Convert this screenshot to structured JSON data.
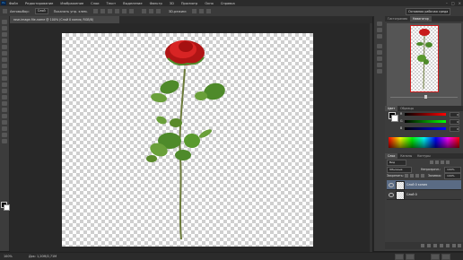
{
  "menu": {
    "app_icon": "Ps",
    "items": [
      "Файл",
      "Редактирование",
      "Изображение",
      "Слои",
      "Текст",
      "Выделение",
      "Фильтр",
      "3D",
      "Просмотр",
      "Окно",
      "Справка"
    ]
  },
  "options": {
    "auto_select_label": "Автовыбор:",
    "auto_select_value": "Слой",
    "transform_label": "Показать упр. элем.",
    "mode_label": "3D-режим:",
    "workspace": "Основная рабочая среда"
  },
  "document": {
    "tab_title": "rose-image-file-name @ 100% (Слой 0 копия, RGB/8)"
  },
  "status": {
    "zoom": "100%",
    "doc_size": "Док: 1,20M/2,71M"
  },
  "panels": {
    "top_tabs": [
      "Гистограмма",
      "Навигатор"
    ],
    "color_tabs": [
      "Цвет",
      "Образцы"
    ],
    "sliders": [
      {
        "label": "R",
        "value": "0"
      },
      {
        "label": "G",
        "value": "0"
      },
      {
        "label": "B",
        "value": "0"
      }
    ],
    "layer_tabs": [
      "Слои",
      "Каналы",
      "Контуры"
    ],
    "kind_label": "Вид",
    "blend_mode": "Обычные",
    "opacity_label": "Непрозрачн.:",
    "opacity_value": "100%",
    "lock_label": "Закрепить:",
    "fill_label": "Заливка:",
    "fill_value": "100%",
    "layers": [
      {
        "name": "Слой 0 копия",
        "selected": true
      },
      {
        "name": "Слой 0",
        "selected": false
      }
    ]
  },
  "colors": {
    "selected_layer": "#5a6b84",
    "rose_red": "#d01e1e",
    "stem_green": "#5a8a2a"
  }
}
